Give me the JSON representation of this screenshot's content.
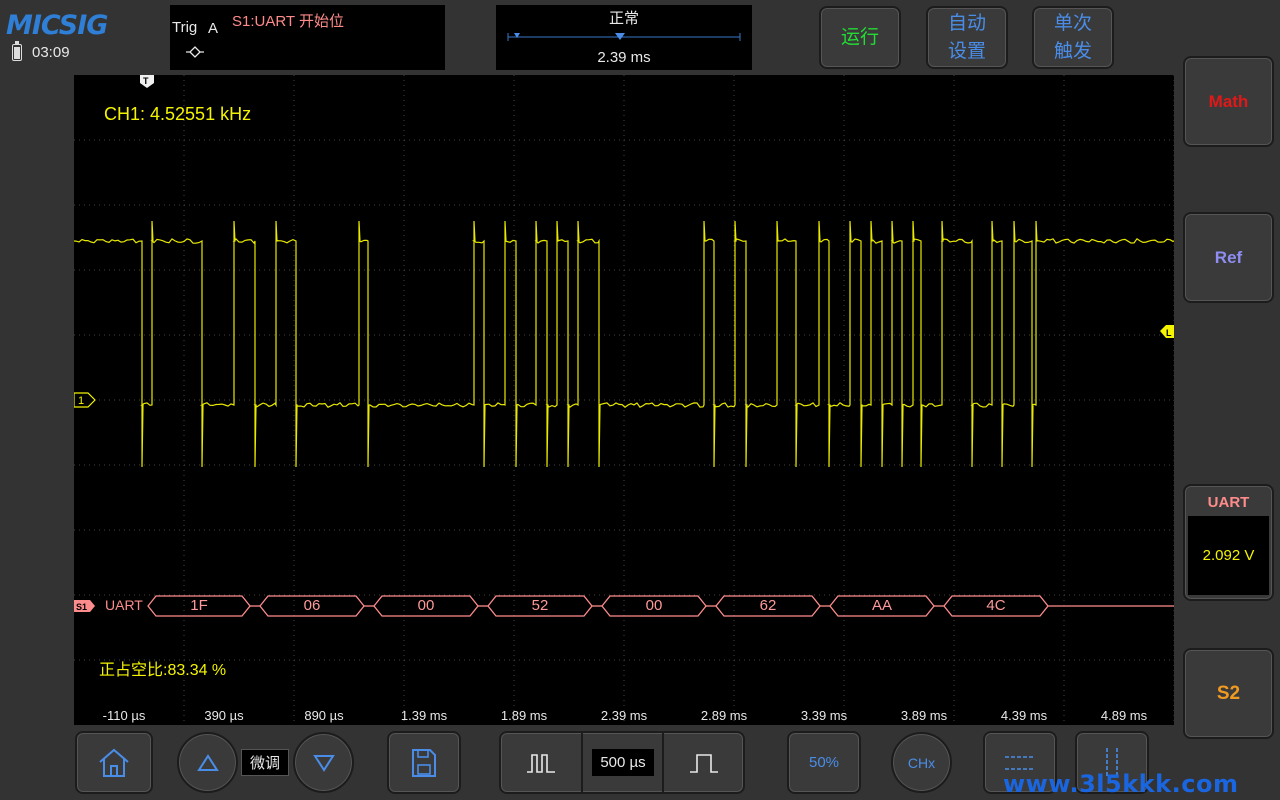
{
  "header": {
    "logo": "MICSIG",
    "time": "03:09"
  },
  "trigger": {
    "label": "Trig",
    "source": "A",
    "description": "S1:UART 开始位",
    "edge_icon": "trigger-edge-icon"
  },
  "acquisition": {
    "mode": "正常",
    "position": "2.39 ms"
  },
  "top_buttons": {
    "run": "运行",
    "auto_line1": "自动",
    "auto_line2": "设置",
    "single_line1": "单次",
    "single_line2": "触发"
  },
  "side_buttons": {
    "math": "Math",
    "ref": "Ref",
    "s2": "S2"
  },
  "measurement": {
    "title": "UART",
    "value": "2.092  V"
  },
  "scope": {
    "frequency": "CH1: 4.52551 kHz",
    "duty_cycle": "正占空比:83.34 %",
    "channel_marker": "1",
    "trigger_marker": "T",
    "level_marker": "L",
    "bus_marker": "S1",
    "bus_label": "UART",
    "bus_bytes": [
      "1F",
      "06",
      "00",
      "52",
      "00",
      "62",
      "AA",
      "4C"
    ],
    "time_ticks": [
      "-110 µs",
      "390 µs",
      "890 µs",
      "1.39 ms",
      "1.89 ms",
      "2.39 ms",
      "2.89 ms",
      "3.39 ms",
      "3.89 ms",
      "4.39 ms",
      "4.89 ms"
    ]
  },
  "bottom_bar": {
    "fine_adjust": "微调",
    "timebase": "500 µs",
    "fifty_percent": "50%",
    "channel": "CHx"
  },
  "watermark": "www.3l5kkk.com",
  "colors": {
    "ch1": "#f4f400",
    "bus": "#ff8c8c",
    "math": "#e01818",
    "ref": "#8e8ef2",
    "s2": "#f09a22",
    "run": "#22dd33",
    "accent": "#4a8de8"
  }
}
